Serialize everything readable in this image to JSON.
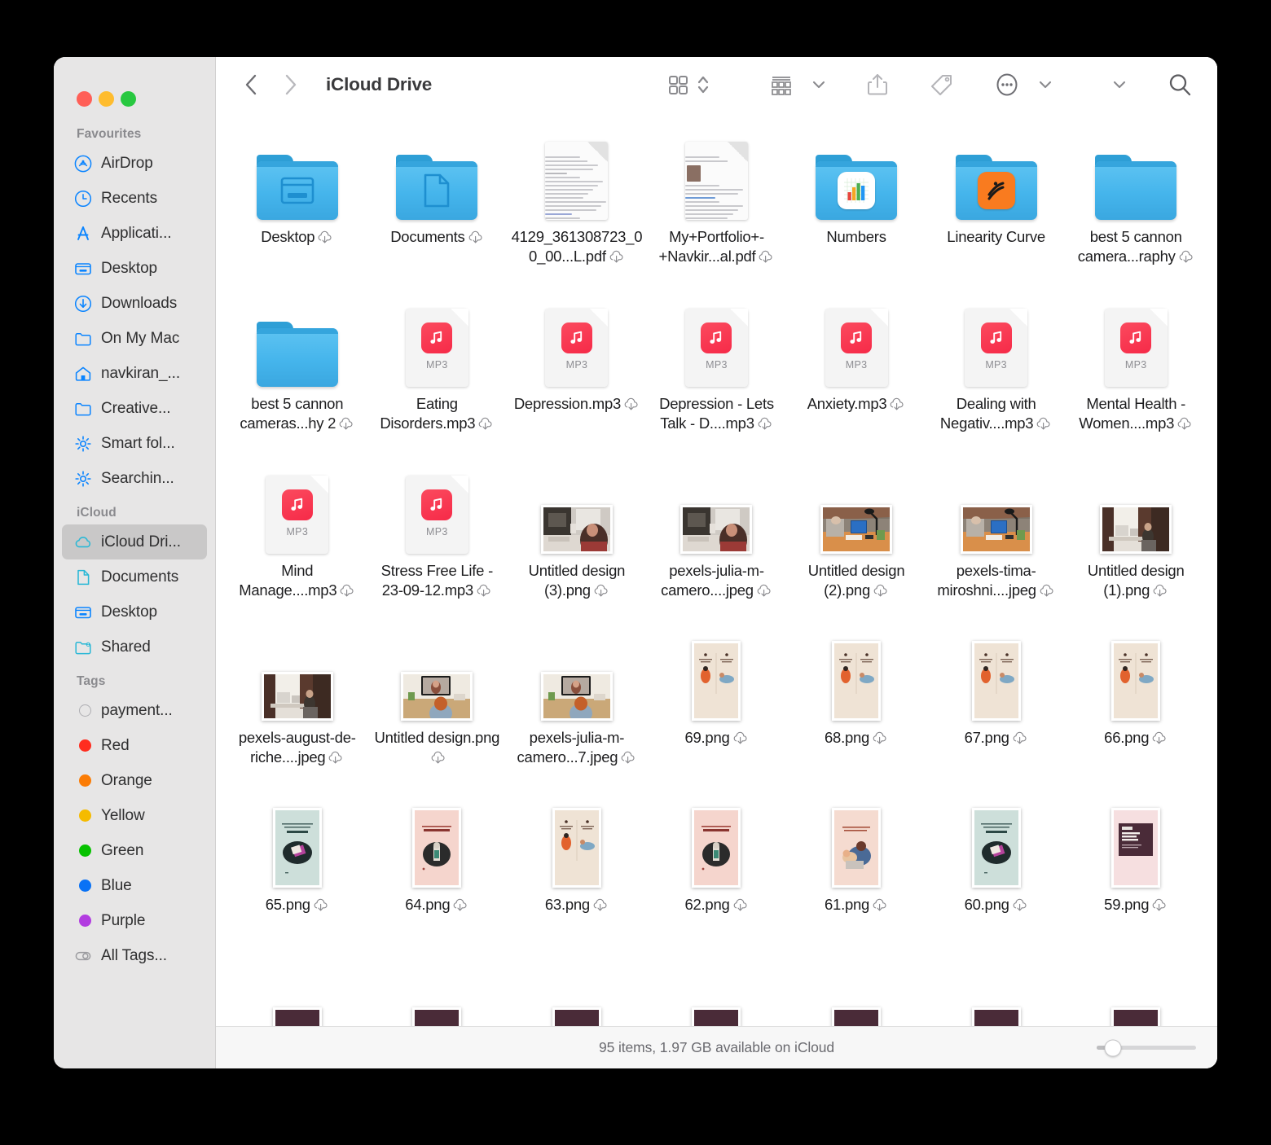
{
  "window": {
    "traffic_lights": [
      {
        "name": "close",
        "color": "#ff5f57"
      },
      {
        "name": "minimize",
        "color": "#febc2e"
      },
      {
        "name": "maximize",
        "color": "#28c840"
      }
    ]
  },
  "toolbar": {
    "back_icon": "chevron-left-icon",
    "forward_icon": "chevron-right-icon",
    "title": "iCloud Drive",
    "view_icon": "grid-view-icon",
    "view_stepper_icon": "updown-chevron-icon",
    "group_icon": "group-by-icon",
    "group_chevron_icon": "chevron-down-icon",
    "share_icon": "share-icon",
    "tag_icon": "tag-icon",
    "more_icon": "ellipsis-circle-icon",
    "more_chevron_icon": "chevron-down-icon",
    "overflow_chevron_icon": "chevron-down-icon",
    "search_icon": "search-icon"
  },
  "sidebar": {
    "groups": [
      {
        "title": "Favourites",
        "items": [
          {
            "label": "AirDrop",
            "icon": "airdrop-icon"
          },
          {
            "label": "Recents",
            "icon": "clock-icon"
          },
          {
            "label": "Applicati...",
            "icon": "appstore-icon"
          },
          {
            "label": "Desktop",
            "icon": "desktop-icon"
          },
          {
            "label": "Downloads",
            "icon": "download-icon"
          },
          {
            "label": "On My Mac",
            "icon": "folder-icon"
          },
          {
            "label": "navkiran_...",
            "icon": "home-icon"
          },
          {
            "label": "Creative...",
            "icon": "folder-icon"
          },
          {
            "label": "Smart fol...",
            "icon": "gear-icon"
          },
          {
            "label": "Searchin...",
            "icon": "gear-icon"
          }
        ]
      },
      {
        "title": "iCloud",
        "items": [
          {
            "label": "iCloud Dri...",
            "icon": "cloud-icon",
            "selected": true
          },
          {
            "label": "Documents",
            "icon": "document-icon"
          },
          {
            "label": "Desktop",
            "icon": "desktop-icon"
          },
          {
            "label": "Shared",
            "icon": "shared-folder-icon"
          }
        ]
      },
      {
        "title": "Tags",
        "items": [
          {
            "label": "payment...",
            "icon": "tag-dot",
            "color": "none"
          },
          {
            "label": "Red",
            "icon": "tag-dot",
            "color": "#ff2d1f"
          },
          {
            "label": "Orange",
            "icon": "tag-dot",
            "color": "#fb7c05"
          },
          {
            "label": "Yellow",
            "icon": "tag-dot",
            "color": "#f5bb00"
          },
          {
            "label": "Green",
            "icon": "tag-dot",
            "color": "#07c200"
          },
          {
            "label": "Blue",
            "icon": "tag-dot",
            "color": "#0a72f5"
          },
          {
            "label": "Purple",
            "icon": "tag-dot",
            "color": "#b23ce0"
          },
          {
            "label": "All Tags...",
            "icon": "all-tags-icon",
            "color": "none"
          }
        ]
      }
    ]
  },
  "files": [
    {
      "name": "Desktop",
      "kind": "folder",
      "glyph": "desktop",
      "cloud": true
    },
    {
      "name": "Documents",
      "kind": "folder",
      "glyph": "document",
      "cloud": true
    },
    {
      "name": "4129_361308723_00_00...L.pdf",
      "kind": "pdf",
      "cloud": true
    },
    {
      "name": "My+Portfolio+-+Navkir...al.pdf",
      "kind": "pdf-photo",
      "cloud": true
    },
    {
      "name": "Numbers",
      "kind": "folder",
      "glyph": "numbers-app",
      "cloud": false
    },
    {
      "name": "Linearity Curve",
      "kind": "folder",
      "glyph": "linearity-app",
      "cloud": false
    },
    {
      "name": "best 5 cannon camera...raphy",
      "kind": "folder",
      "glyph": "plain",
      "cloud": true
    },
    {
      "name": "best 5 cannon cameras...hy 2",
      "kind": "folder",
      "glyph": "plain",
      "cloud": true
    },
    {
      "name": "Eating Disorders.mp3",
      "kind": "mp3",
      "ext": "MP3",
      "cloud": true
    },
    {
      "name": "Depression.mp3",
      "kind": "mp3",
      "ext": "MP3",
      "cloud": true
    },
    {
      "name": "Depression - Lets Talk -  D....mp3",
      "kind": "mp3",
      "ext": "MP3",
      "cloud": true
    },
    {
      "name": "Anxiety.mp3",
      "kind": "mp3",
      "ext": "MP3",
      "cloud": true
    },
    {
      "name": "Dealing with Negativ....mp3",
      "kind": "mp3",
      "ext": "MP3",
      "cloud": true
    },
    {
      "name": "Mental Health - Women....mp3",
      "kind": "mp3",
      "ext": "MP3",
      "cloud": true
    },
    {
      "name": "Mind Manage....mp3",
      "kind": "mp3",
      "ext": "MP3",
      "cloud": true
    },
    {
      "name": "Stress Free Life - 23-09-12.mp3",
      "kind": "mp3",
      "ext": "MP3",
      "cloud": true
    },
    {
      "name": "Untitled design (3).png",
      "kind": "photo-landscape",
      "theme": "desk-woman",
      "cloud": true
    },
    {
      "name": "pexels-julia-m-camero....jpeg",
      "kind": "photo-landscape",
      "theme": "desk-woman",
      "cloud": true
    },
    {
      "name": "Untitled design (2).png",
      "kind": "photo-landscape",
      "theme": "desk-lamp",
      "cloud": true
    },
    {
      "name": "pexels-tima-miroshni....jpeg",
      "kind": "photo-landscape",
      "theme": "desk-lamp",
      "cloud": true
    },
    {
      "name": "Untitled design (1).png",
      "kind": "photo-landscape",
      "theme": "room-desk",
      "cloud": true
    },
    {
      "name": "pexels-august-de-riche....jpeg",
      "kind": "photo-landscape",
      "theme": "room-desk",
      "cloud": true
    },
    {
      "name": "Untitled design.png",
      "kind": "photo-landscape",
      "theme": "video-call",
      "cloud": true
    },
    {
      "name": "pexels-julia-m-camero...7.jpeg",
      "kind": "photo-landscape",
      "theme": "video-call",
      "cloud": true
    },
    {
      "name": "69.png",
      "kind": "photo-portrait",
      "theme": "beige-duo",
      "cloud": true
    },
    {
      "name": "68.png",
      "kind": "photo-portrait",
      "theme": "beige-duo",
      "cloud": true
    },
    {
      "name": "67.png",
      "kind": "photo-portrait",
      "theme": "beige-duo",
      "cloud": true
    },
    {
      "name": "66.png",
      "kind": "photo-portrait",
      "theme": "beige-duo",
      "cloud": true
    },
    {
      "name": "65.png",
      "kind": "photo-portrait",
      "theme": "mint-card",
      "cloud": true
    },
    {
      "name": "64.png",
      "kind": "photo-portrait",
      "theme": "pink-card",
      "cloud": true
    },
    {
      "name": "63.png",
      "kind": "photo-portrait",
      "theme": "beige-duo",
      "cloud": true
    },
    {
      "name": "62.png",
      "kind": "photo-portrait",
      "theme": "pink-card",
      "cloud": true
    },
    {
      "name": "61.png",
      "kind": "photo-portrait",
      "theme": "peach-card",
      "cloud": true
    },
    {
      "name": "60.png",
      "kind": "photo-portrait",
      "theme": "mint-card",
      "cloud": true
    },
    {
      "name": "59.png",
      "kind": "photo-portrait",
      "theme": "plum-card",
      "cloud": true
    },
    {
      "name": "",
      "kind": "photo-portrait-partial",
      "theme": "plum-head",
      "cloud": false
    },
    {
      "name": "",
      "kind": "photo-portrait-partial",
      "theme": "plum-head",
      "cloud": false
    },
    {
      "name": "",
      "kind": "photo-portrait-partial",
      "theme": "plum-head",
      "cloud": false
    },
    {
      "name": "",
      "kind": "photo-portrait-partial",
      "theme": "plum-head",
      "cloud": false
    },
    {
      "name": "",
      "kind": "photo-portrait-partial",
      "theme": "plum-head",
      "cloud": false
    },
    {
      "name": "",
      "kind": "photo-portrait-partial",
      "theme": "plum-head-alt",
      "cloud": false
    },
    {
      "name": "",
      "kind": "photo-portrait-partial",
      "theme": "plum-head",
      "cloud": false
    }
  ],
  "status": {
    "text": "95 items, 1.97 GB available on iCloud",
    "zoom_percent": 16
  }
}
